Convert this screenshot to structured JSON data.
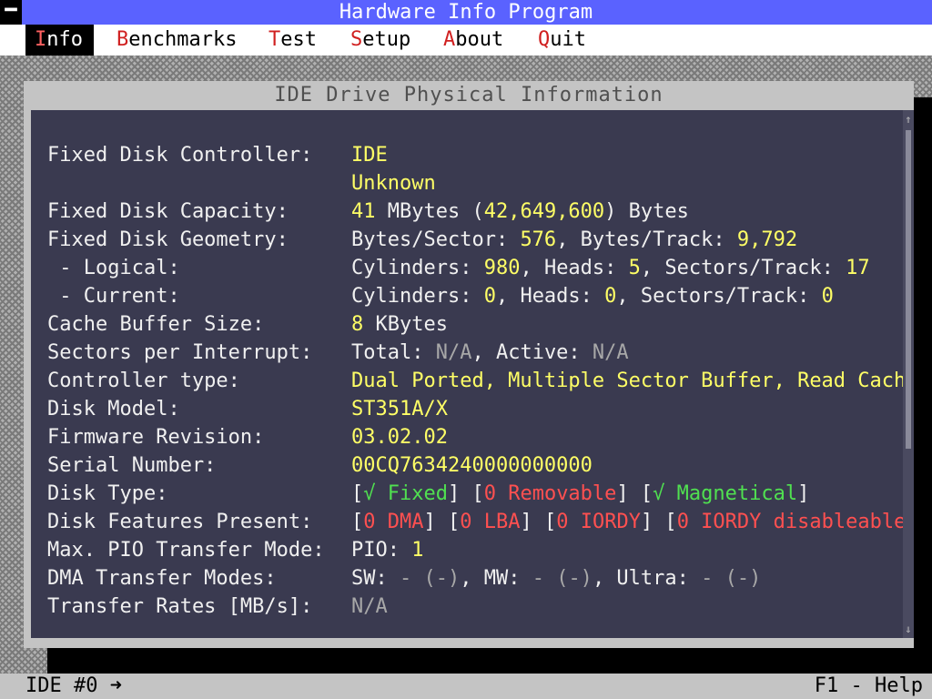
{
  "app": {
    "title": "Hardware Info Program",
    "system_menu_icon": "minus-icon"
  },
  "menu": [
    {
      "hot": "I",
      "rest": "nfo",
      "active": true
    },
    {
      "hot": "B",
      "rest": "enchmarks",
      "active": false
    },
    {
      "hot": "T",
      "rest": "est",
      "active": false
    },
    {
      "hot": "S",
      "rest": "etup",
      "active": false
    },
    {
      "hot": "A",
      "rest": "bout",
      "active": false
    },
    {
      "hot": "Q",
      "rest": "uit",
      "active": false
    }
  ],
  "window": {
    "title": "IDE Drive Physical Information",
    "rows": [
      {
        "label": "Fixed Disk Controller:",
        "segments": [
          {
            "t": "IDE",
            "c": "y"
          }
        ]
      },
      {
        "label": "",
        "segments": [
          {
            "t": "Unknown",
            "c": "y"
          }
        ]
      },
      {
        "label": "Fixed Disk Capacity:",
        "segments": [
          {
            "t": "41",
            "c": "y"
          },
          {
            "t": " MBytes (",
            "c": "w"
          },
          {
            "t": "42,649,600",
            "c": "y"
          },
          {
            "t": ") Bytes",
            "c": "w"
          }
        ]
      },
      {
        "label": "Fixed Disk Geometry:",
        "segments": [
          {
            "t": "Bytes/Sector: ",
            "c": "w"
          },
          {
            "t": "576",
            "c": "y"
          },
          {
            "t": ", Bytes/Track: ",
            "c": "w"
          },
          {
            "t": "9,792",
            "c": "y"
          }
        ]
      },
      {
        "label": " - Logical:",
        "segments": [
          {
            "t": "Cylinders: ",
            "c": "w"
          },
          {
            "t": "980",
            "c": "y"
          },
          {
            "t": ", Heads: ",
            "c": "w"
          },
          {
            "t": "5",
            "c": "y"
          },
          {
            "t": ", Sectors/Track: ",
            "c": "w"
          },
          {
            "t": "17",
            "c": "y"
          }
        ]
      },
      {
        "label": " - Current:",
        "segments": [
          {
            "t": "Cylinders: ",
            "c": "w"
          },
          {
            "t": "0",
            "c": "y"
          },
          {
            "t": ", Heads: ",
            "c": "w"
          },
          {
            "t": "0",
            "c": "y"
          },
          {
            "t": ", Sectors/Track: ",
            "c": "w"
          },
          {
            "t": "0",
            "c": "y"
          }
        ]
      },
      {
        "label": "Cache Buffer Size:",
        "segments": [
          {
            "t": "8",
            "c": "y"
          },
          {
            "t": " KBytes",
            "c": "w"
          }
        ]
      },
      {
        "label": "Sectors per Interrupt:",
        "segments": [
          {
            "t": "Total: ",
            "c": "w"
          },
          {
            "t": "N/A",
            "c": "g"
          },
          {
            "t": ", Active: ",
            "c": "w"
          },
          {
            "t": "N/A",
            "c": "g"
          }
        ]
      },
      {
        "label": "Controller type:",
        "segments": [
          {
            "t": "Dual Ported, Multiple Sector Buffer, Read Cache",
            "c": "y"
          }
        ]
      },
      {
        "label": "Disk Model:",
        "segments": [
          {
            "t": "ST351A/X",
            "c": "y"
          }
        ]
      },
      {
        "label": "Firmware Revision:",
        "segments": [
          {
            "t": "03.02.02",
            "c": "y"
          }
        ]
      },
      {
        "label": "Serial Number:",
        "segments": [
          {
            "t": "00CQ7634240000000000",
            "c": "y"
          }
        ]
      },
      {
        "label": "Disk Type:",
        "segments": [
          {
            "t": "[",
            "c": "w"
          },
          {
            "t": "√ Fixed",
            "c": "gr"
          },
          {
            "t": "] [",
            "c": "w"
          },
          {
            "t": "0 Removable",
            "c": "r"
          },
          {
            "t": "] [",
            "c": "w"
          },
          {
            "t": "√ Magnetical",
            "c": "gr"
          },
          {
            "t": "]",
            "c": "w"
          }
        ]
      },
      {
        "label": "Disk Features Present:",
        "segments": [
          {
            "t": "[",
            "c": "w"
          },
          {
            "t": "0 DMA",
            "c": "r"
          },
          {
            "t": "] [",
            "c": "w"
          },
          {
            "t": "0 LBA",
            "c": "r"
          },
          {
            "t": "] [",
            "c": "w"
          },
          {
            "t": "0 IORDY",
            "c": "r"
          },
          {
            "t": "] [",
            "c": "w"
          },
          {
            "t": "0 IORDY disableable",
            "c": "r"
          },
          {
            "t": "]",
            "c": "w"
          }
        ]
      },
      {
        "label": "Max. PIO Transfer Mode:",
        "segments": [
          {
            "t": "PIO: ",
            "c": "w"
          },
          {
            "t": "1",
            "c": "y"
          }
        ]
      },
      {
        "label": "DMA Transfer Modes:",
        "segments": [
          {
            "t": "SW: ",
            "c": "w"
          },
          {
            "t": "- (-)",
            "c": "g"
          },
          {
            "t": ", MW: ",
            "c": "w"
          },
          {
            "t": "- (-)",
            "c": "g"
          },
          {
            "t": ", Ultra: ",
            "c": "w"
          },
          {
            "t": "- (-)",
            "c": "g"
          }
        ]
      },
      {
        "label": "Transfer Rates [MB/s]:",
        "segments": [
          {
            "t": "N/A",
            "c": "g"
          }
        ]
      }
    ]
  },
  "status": {
    "left": "IDE #0 ➜",
    "right": "F1 - Help"
  }
}
